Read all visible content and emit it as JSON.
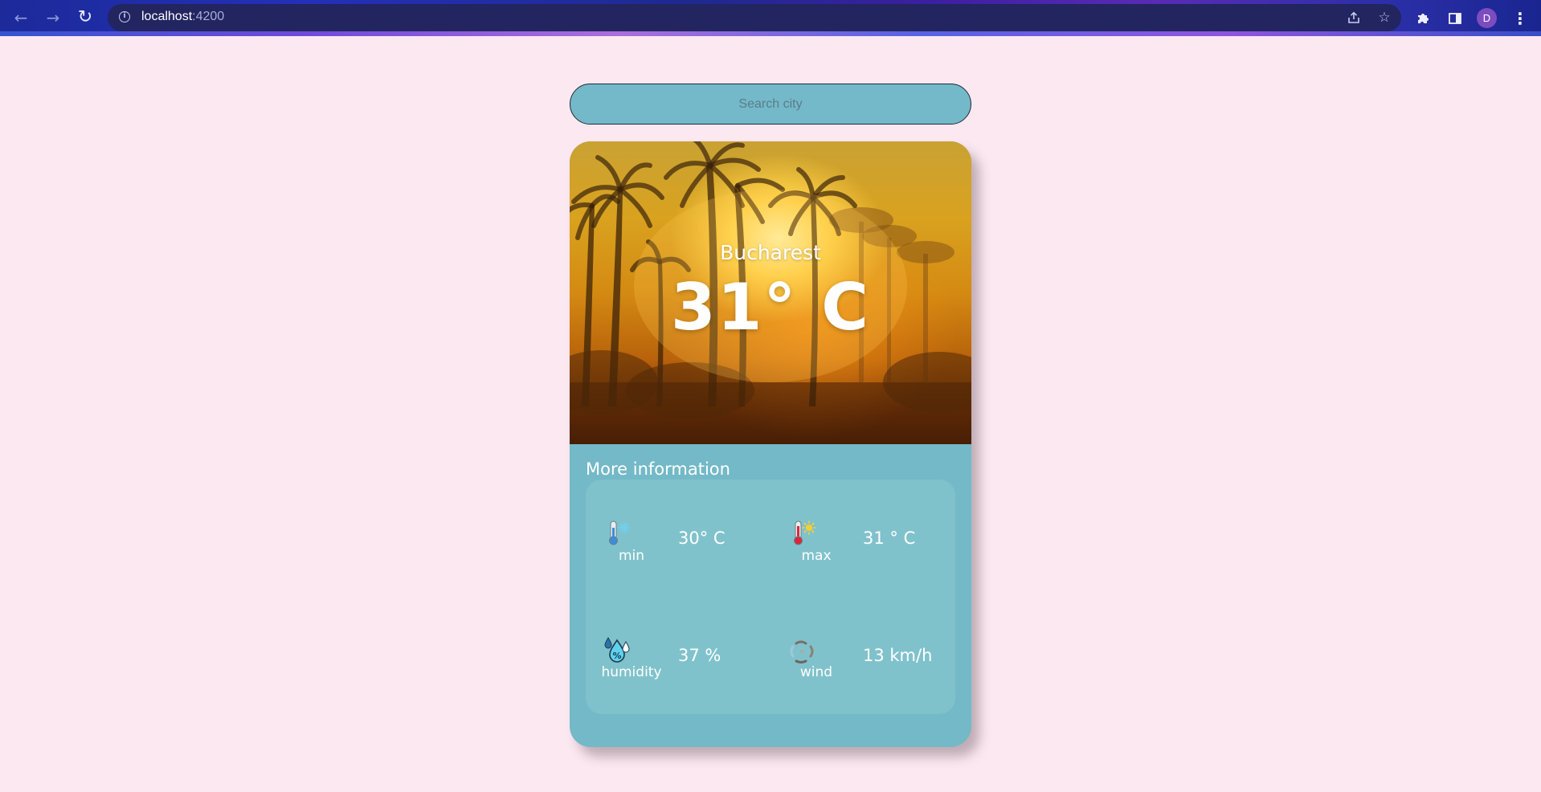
{
  "browser": {
    "url_host": "localhost",
    "url_port": ":4200",
    "profile_initial": "D",
    "icons": [
      "back-arrow-icon",
      "forward-arrow-icon",
      "reload-icon",
      "info-icon",
      "share-icon",
      "star-icon",
      "puzzle-icon",
      "side-panel-icon",
      "more-vert-icon"
    ]
  },
  "search": {
    "placeholder": "Search city",
    "value": ""
  },
  "weather": {
    "city": "Bucharest",
    "temperature": "31° C",
    "background": "palm-trees-sunset"
  },
  "details": {
    "title": "More information",
    "items": [
      {
        "icon": "thermometer-cold-icon",
        "label": "min",
        "value": "30° C"
      },
      {
        "icon": "thermometer-hot-icon",
        "label": "max",
        "value": "31 ° C"
      },
      {
        "icon": "humidity-drops-icon",
        "label": "humidity",
        "value": "37 %"
      },
      {
        "icon": "wind-icon",
        "label": "wind",
        "value": "13 km/h"
      }
    ]
  },
  "colors": {
    "page_bg": "#fce8f1",
    "accent": "#73b9c7",
    "panel": "#80c2cc"
  }
}
